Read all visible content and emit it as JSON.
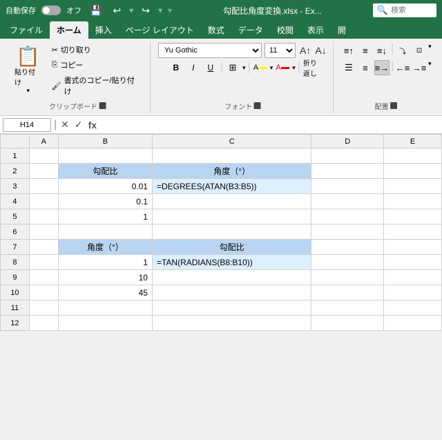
{
  "titlebar": {
    "autosave_label": "自動保存",
    "toggle_state": "オフ",
    "filename": "勾配比角度変換.xlsx - Ex...",
    "search_placeholder": "検索"
  },
  "ribbon_tabs": [
    {
      "label": "ファイル"
    },
    {
      "label": "ホーム",
      "active": true
    },
    {
      "label": "挿入"
    },
    {
      "label": "ページ レイアウト"
    },
    {
      "label": "数式"
    },
    {
      "label": "データ"
    },
    {
      "label": "校閲"
    },
    {
      "label": "表示"
    },
    {
      "label": "開"
    }
  ],
  "ribbon": {
    "clipboard_group": "クリップボード",
    "paste_label": "貼り付け",
    "cut_label": "切り取り",
    "copy_label": "コピー",
    "format_painter_label": "書式のコピー/貼り付け",
    "font_group": "フォント",
    "font_name": "Yu Gothic",
    "font_size": "11",
    "bold": "B",
    "italic": "I",
    "underline": "U",
    "alignment_group": "配置",
    "expand_icon": "▾"
  },
  "formula_bar": {
    "cell_ref": "H14",
    "formula": ""
  },
  "columns": [
    "A",
    "B",
    "C",
    "D",
    "E"
  ],
  "rows": [
    {
      "row": "1",
      "cells": {
        "A": "",
        "B": "",
        "C": "",
        "D": "",
        "E": ""
      }
    },
    {
      "row": "2",
      "cells": {
        "A": "",
        "B": "勾配比",
        "C": "角度（°）",
        "D": "",
        "E": ""
      }
    },
    {
      "row": "3",
      "cells": {
        "A": "",
        "B": "0.01",
        "C": "=DEGREES(ATAN(B3:B5))",
        "D": "",
        "E": ""
      }
    },
    {
      "row": "4",
      "cells": {
        "A": "",
        "B": "0.1",
        "C": "",
        "D": "",
        "E": ""
      }
    },
    {
      "row": "5",
      "cells": {
        "A": "",
        "B": "1",
        "C": "",
        "D": "",
        "E": ""
      }
    },
    {
      "row": "6",
      "cells": {
        "A": "",
        "B": "",
        "C": "",
        "D": "",
        "E": ""
      }
    },
    {
      "row": "7",
      "cells": {
        "A": "",
        "B": "角度（°）",
        "C": "勾配比",
        "D": "",
        "E": ""
      }
    },
    {
      "row": "8",
      "cells": {
        "A": "",
        "B": "1",
        "C": "=TAN(RADIANS(B8:B10))",
        "D": "",
        "E": ""
      }
    },
    {
      "row": "9",
      "cells": {
        "A": "",
        "B": "10",
        "C": "",
        "D": "",
        "E": ""
      }
    },
    {
      "row": "10",
      "cells": {
        "A": "",
        "B": "45",
        "C": "",
        "D": "",
        "E": ""
      }
    },
    {
      "row": "11",
      "cells": {
        "A": "",
        "B": "",
        "C": "",
        "D": "",
        "E": ""
      }
    },
    {
      "row": "12",
      "cells": {
        "A": "",
        "B": "",
        "C": "",
        "D": "",
        "E": ""
      }
    }
  ]
}
